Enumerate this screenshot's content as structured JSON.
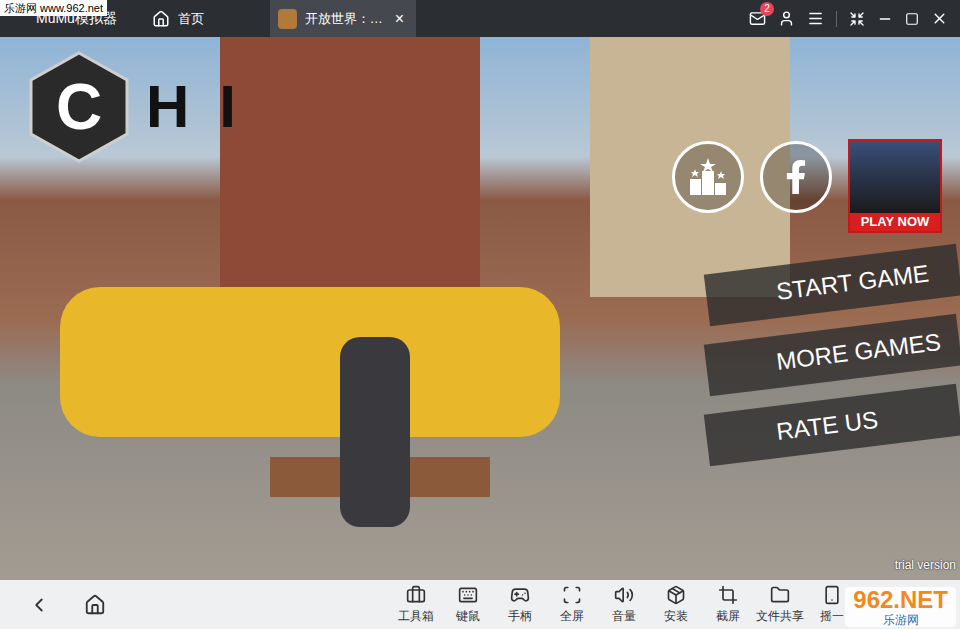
{
  "window": {
    "title": "MuMu模拟器"
  },
  "watermarks": {
    "top_left": "乐游网 www.962.net",
    "bottom_right_big": "962.NET",
    "bottom_right_small": "乐游网"
  },
  "tabs": [
    {
      "label": "首页",
      "selected": false
    },
    {
      "label": "开放世界：…",
      "selected": true,
      "close": "×"
    }
  ],
  "title_bar": {
    "mail_badge": "2"
  },
  "game": {
    "logo_letter": "C",
    "logo_text": "HI",
    "ad": {
      "label": "PLAY NOW"
    },
    "menu": [
      "START GAME",
      "MORE GAMES",
      "RATE US"
    ],
    "footer": "trial version"
  },
  "toolbar": {
    "items": [
      "工具箱",
      "键鼠",
      "手柄",
      "全屏",
      "音量",
      "安装",
      "截屏",
      "文件共享",
      "摇一"
    ]
  }
}
